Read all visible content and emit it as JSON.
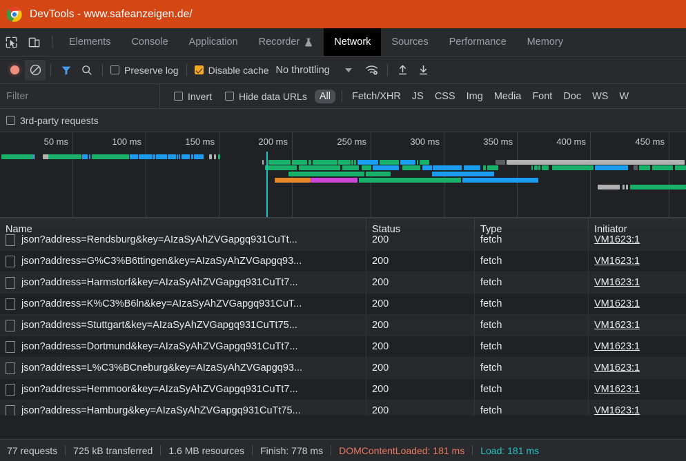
{
  "window": {
    "title": "DevTools - www.safeanzeigen.de/",
    "titlebar_bg": "#d44715",
    "logo_icon": "chrome-logo-icon"
  },
  "tabbar": {
    "inspect_icon": "inspect-element-icon",
    "device_icon": "device-toolbar-icon",
    "tabs": [
      {
        "label": "Elements",
        "active": false
      },
      {
        "label": "Console",
        "active": false
      },
      {
        "label": "Application",
        "active": false
      },
      {
        "label": "Recorder",
        "active": false,
        "badge_icon": "experiment-flask-icon"
      },
      {
        "label": "Network",
        "active": true
      },
      {
        "label": "Sources",
        "active": false
      },
      {
        "label": "Performance",
        "active": false
      },
      {
        "label": "Memory",
        "active": false
      }
    ]
  },
  "toolbar": {
    "record_icon": "record-stop-icon",
    "clear_icon": "clear-network-log-icon",
    "filter_icon": "filter-funnel-icon",
    "search_icon": "search-icon",
    "preserve_log": {
      "label": "Preserve log",
      "checked": false
    },
    "disable_cache": {
      "label": "Disable cache",
      "checked": true
    },
    "throttling": {
      "value": "No throttling",
      "caret_icon": "chevron-down-icon"
    },
    "network_conditions_icon": "wifi-settings-icon",
    "export_icon": "export-har-icon",
    "import_icon": "import-har-icon",
    "accent_checked_color": "#f5a623"
  },
  "filterbar": {
    "filter_placeholder": "Filter",
    "invert": {
      "label": "Invert",
      "checked": false
    },
    "hide_data_urls": {
      "label": "Hide data URLs",
      "checked": false
    },
    "types": [
      {
        "label": "All",
        "selected": true
      },
      {
        "label": "Fetch/XHR",
        "selected": false
      },
      {
        "label": "JS",
        "selected": false
      },
      {
        "label": "CSS",
        "selected": false
      },
      {
        "label": "Img",
        "selected": false
      },
      {
        "label": "Media",
        "selected": false
      },
      {
        "label": "Font",
        "selected": false
      },
      {
        "label": "Doc",
        "selected": false
      },
      {
        "label": "WS",
        "selected": false
      },
      {
        "label": "W",
        "selected": false
      }
    ],
    "third_party": {
      "label": "3rd-party requests",
      "checked": false
    }
  },
  "overview": {
    "ticks": [
      "50 ms",
      "100 ms",
      "150 ms",
      "200 ms",
      "250 ms",
      "300 ms",
      "350 ms",
      "400 ms",
      "450 ms"
    ],
    "dcl_marker_color": "#e8795d",
    "load_marker_color": "#22c1c3",
    "bar_colors": {
      "receiving": "#17b169",
      "waiting": "#1a9cf0",
      "queueing": "#b2b2b2",
      "stalled": "#e8862a",
      "dns": "#cb48d8"
    }
  },
  "table": {
    "columns": [
      "Name",
      "Status",
      "Type",
      "Initiator"
    ],
    "rows": [
      {
        "name": "json?address=Rendsburg&key=AIzaSyAhZVGapgq931CuTt...",
        "status": "200",
        "type": "fetch",
        "initiator": "VM1623:1"
      },
      {
        "name": "json?address=G%C3%B6ttingen&key=AIzaSyAhZVGapgq93...",
        "status": "200",
        "type": "fetch",
        "initiator": "VM1623:1"
      },
      {
        "name": "json?address=Harmstorf&key=AIzaSyAhZVGapgq931CuTt7...",
        "status": "200",
        "type": "fetch",
        "initiator": "VM1623:1"
      },
      {
        "name": "json?address=K%C3%B6ln&key=AIzaSyAhZVGapgq931CuT...",
        "status": "200",
        "type": "fetch",
        "initiator": "VM1623:1"
      },
      {
        "name": "json?address=Stuttgart&key=AIzaSyAhZVGapgq931CuTt75...",
        "status": "200",
        "type": "fetch",
        "initiator": "VM1623:1"
      },
      {
        "name": "json?address=Dortmund&key=AIzaSyAhZVGapgq931CuTt7...",
        "status": "200",
        "type": "fetch",
        "initiator": "VM1623:1"
      },
      {
        "name": "json?address=L%C3%BCneburg&key=AIzaSyAhZVGapgq93...",
        "status": "200",
        "type": "fetch",
        "initiator": "VM1623:1"
      },
      {
        "name": "json?address=Hemmoor&key=AIzaSyAhZVGapgq931CuTt7...",
        "status": "200",
        "type": "fetch",
        "initiator": "VM1623:1"
      },
      {
        "name": "json?address=Hamburg&key=AIzaSyAhZVGapgq931CuTt75...",
        "status": "200",
        "type": "fetch",
        "initiator": "VM1623:1"
      }
    ]
  },
  "statusbar": {
    "requests": "77 requests",
    "transferred": "725 kB transferred",
    "resources": "1.6 MB resources",
    "finish": "Finish: 778 ms",
    "dom_content_loaded": "DOMContentLoaded: 181 ms",
    "load": "Load: 181 ms"
  }
}
